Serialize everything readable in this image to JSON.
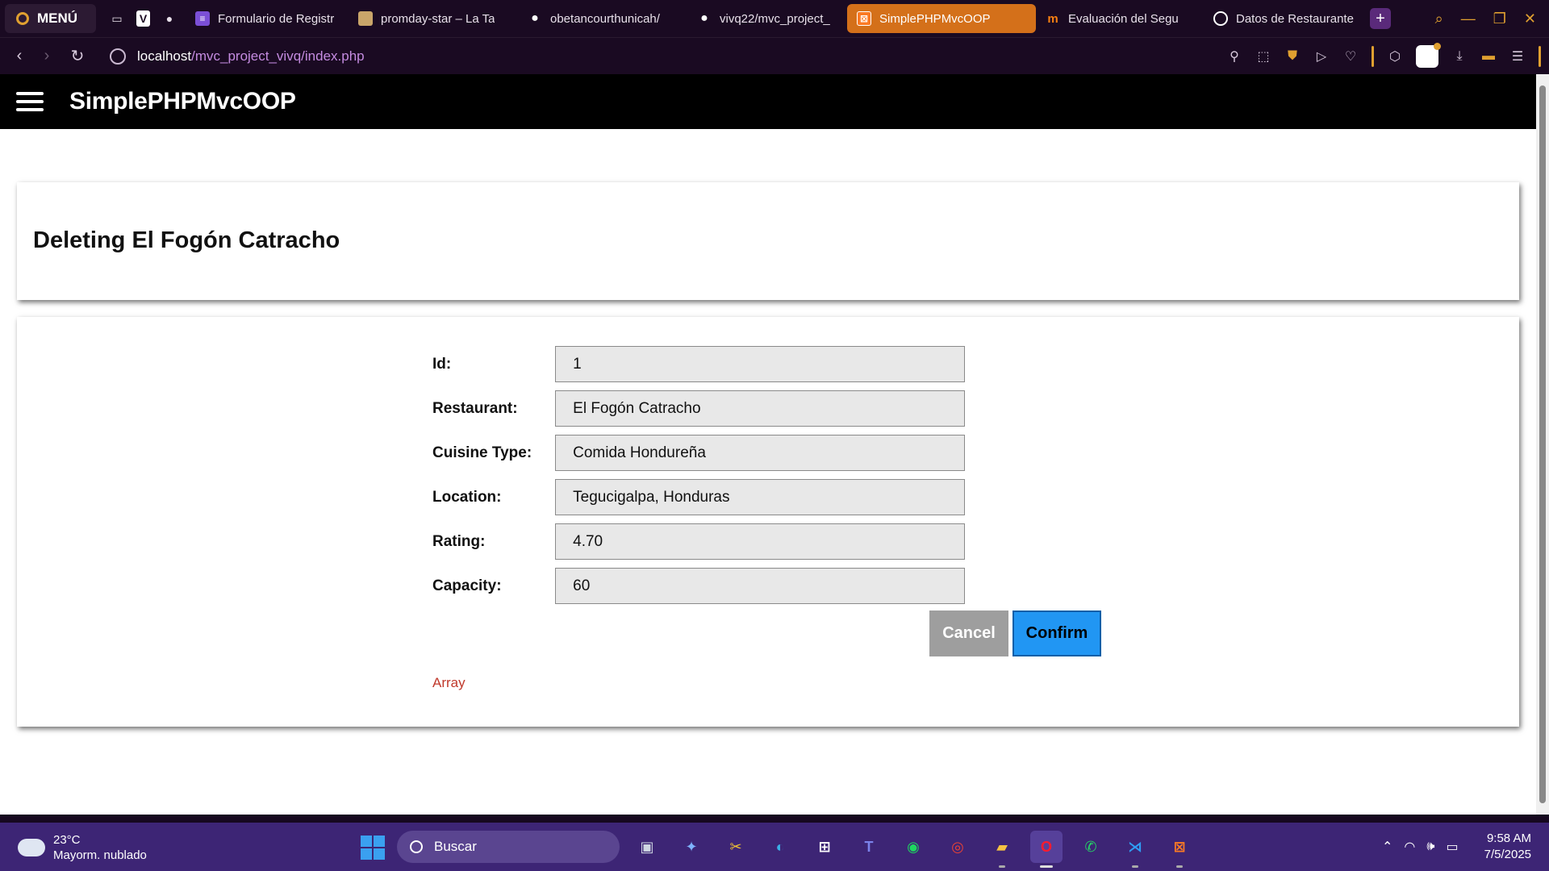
{
  "browser": {
    "menu_label": "MENÚ",
    "tabs": [
      {
        "label": "Formulario de Registr",
        "icon": "form-icon",
        "color": "#7b4fd6"
      },
      {
        "label": "promday-star – La Ta",
        "icon": "page-icon",
        "color": "#c9a56a"
      },
      {
        "label": "obetancourthunicah/",
        "icon": "github-icon",
        "color": "#ffffff"
      },
      {
        "label": "vivq22/mvc_project_",
        "icon": "github-icon",
        "color": "#ffffff"
      },
      {
        "label": "SimplePHPMvcOOP",
        "icon": "xampp-icon",
        "color": "#fb7a24",
        "active": true
      },
      {
        "label": "Evaluación del Segu",
        "icon": "moodle-icon",
        "color": "#f98012"
      },
      {
        "label": "Datos de Restaurante",
        "icon": "chatgpt-icon",
        "color": "#ffffff"
      }
    ],
    "url_host": "localhost",
    "url_path": "/mvc_project_vivq/index.php",
    "accent_color": "#e0a030"
  },
  "app": {
    "title": "SimplePHPMvcOOP"
  },
  "page": {
    "heading": "Deleting El Fogón Catracho",
    "fields": [
      {
        "label": "Id:",
        "value": "1"
      },
      {
        "label": "Restaurant:",
        "value": "El Fogón Catracho"
      },
      {
        "label": "Cuisine Type:",
        "value": "Comida Hondureña"
      },
      {
        "label": "Location:",
        "value": "Tegucigalpa, Honduras"
      },
      {
        "label": "Rating:",
        "value": "4.70"
      },
      {
        "label": "Capacity:",
        "value": "60"
      }
    ],
    "cancel_label": "Cancel",
    "confirm_label": "Confirm",
    "debug_text": "Array",
    "confirm_color": "#2196f3",
    "debug_color": "#c0392b"
  },
  "taskbar": {
    "weather_temp": "23°C",
    "weather_desc": "Mayorm. nublado",
    "search_placeholder": "Buscar",
    "time": "9:58 AM",
    "date": "7/5/2025"
  }
}
